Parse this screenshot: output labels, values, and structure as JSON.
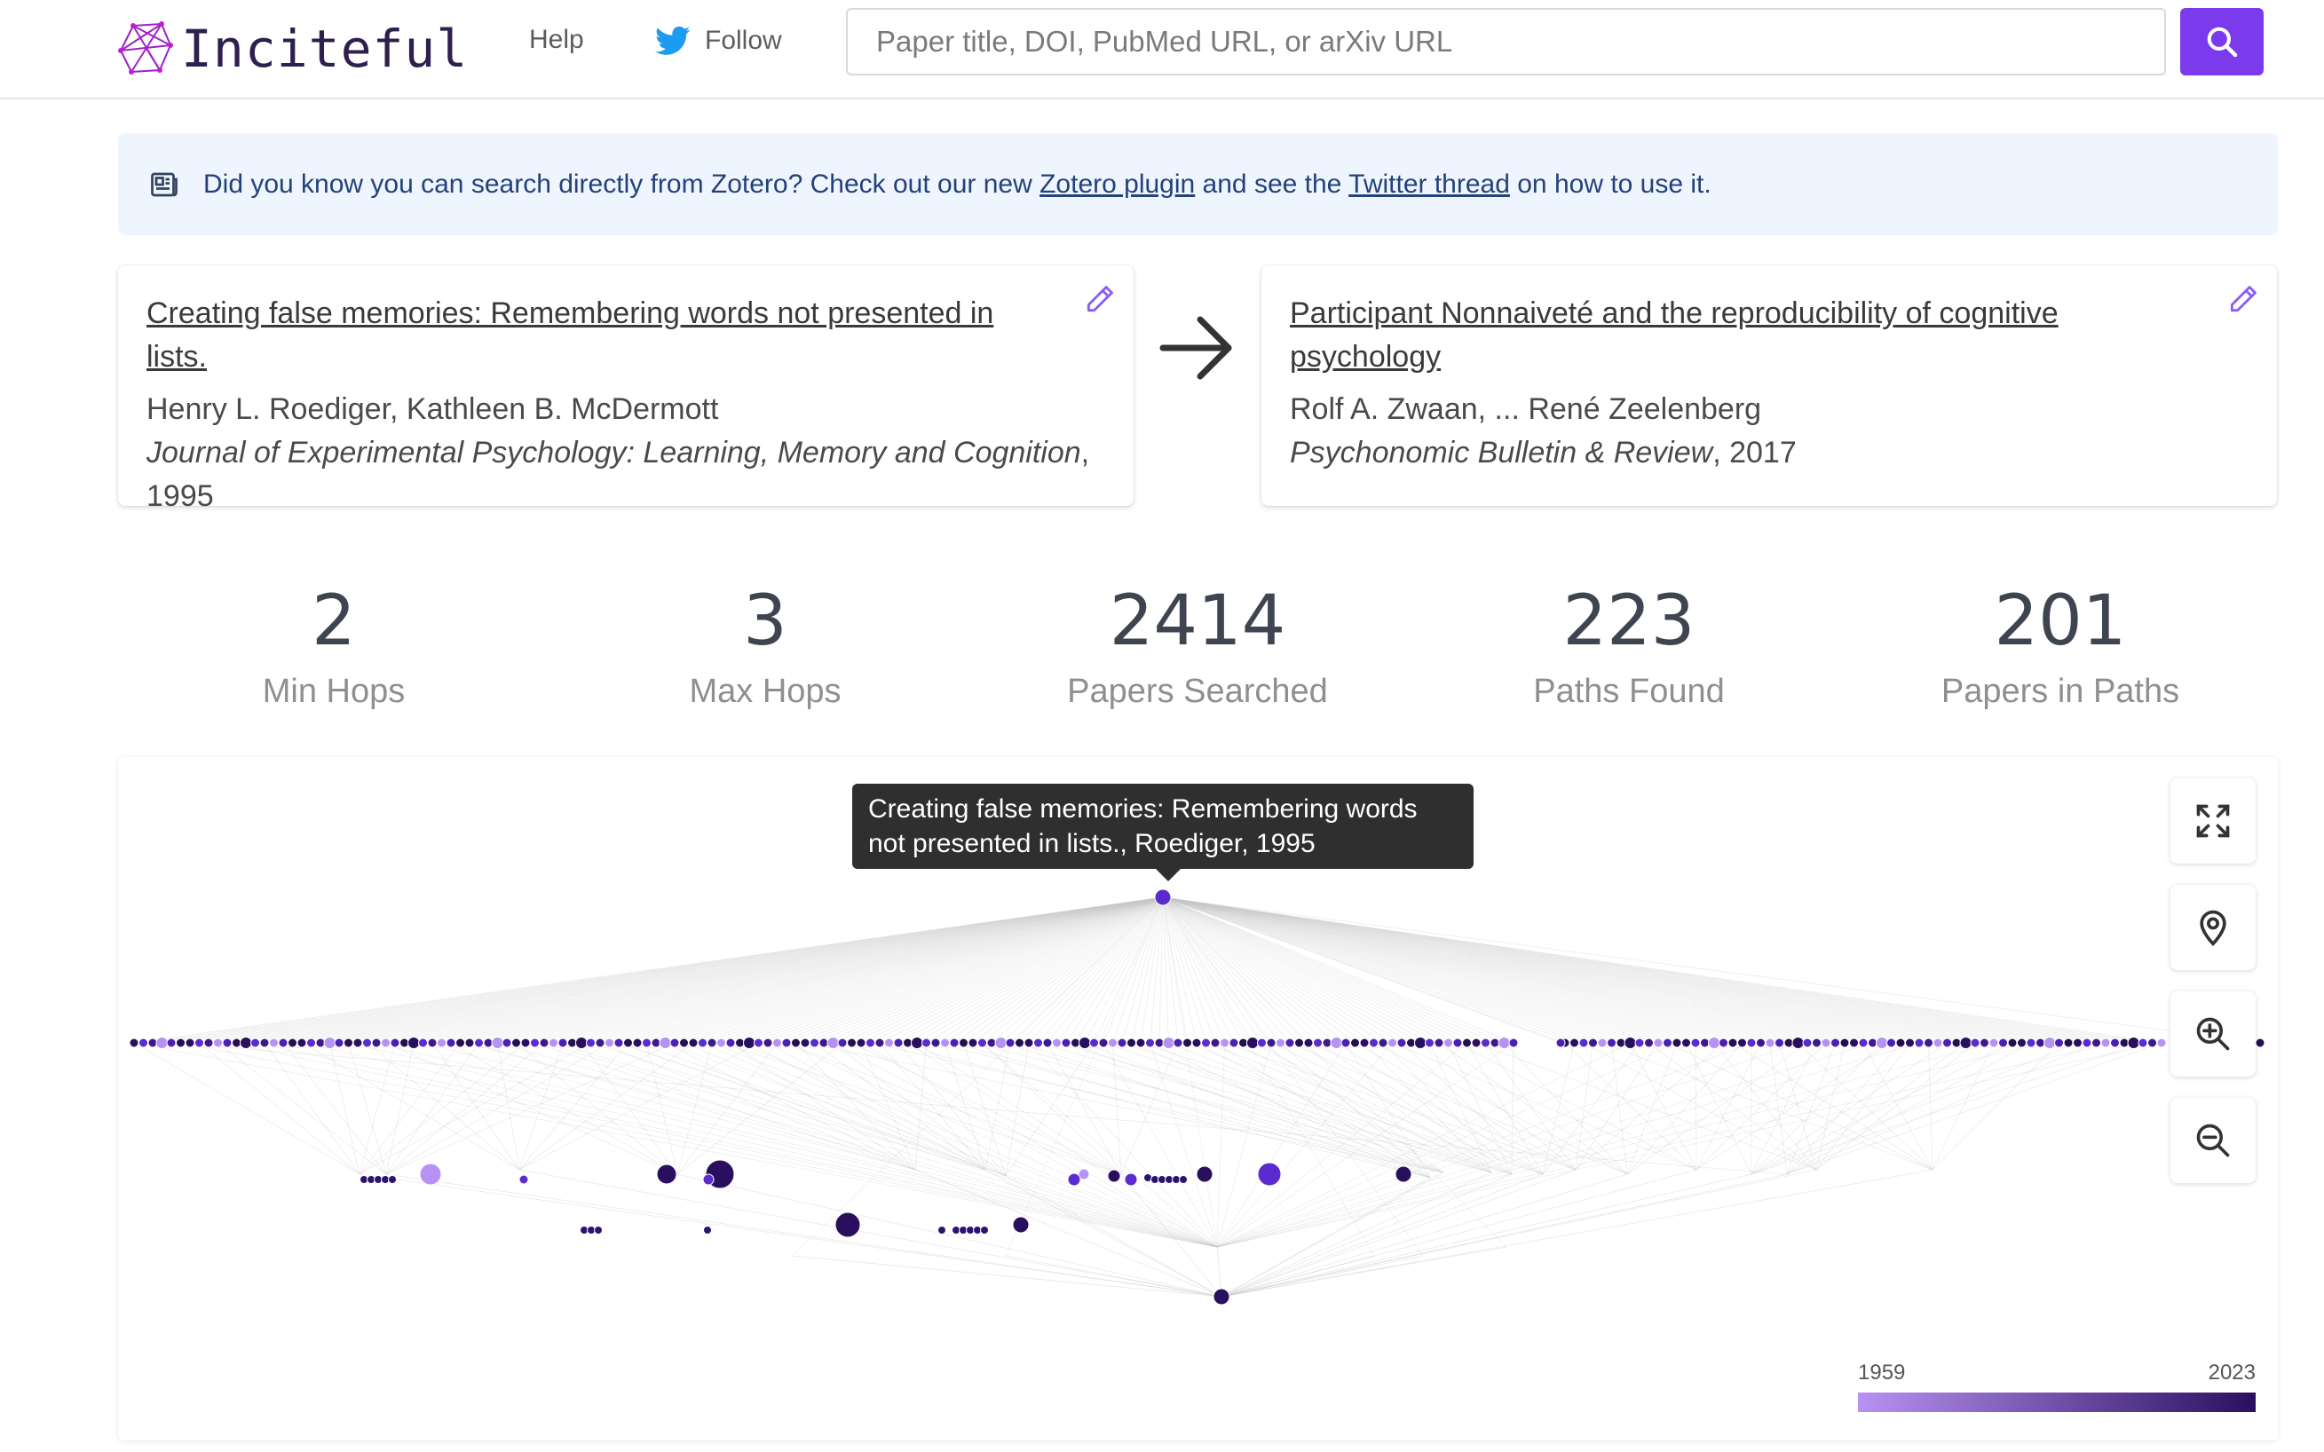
{
  "navbar": {
    "brand": "Inciteful",
    "help": "Help",
    "follow": "Follow",
    "search_placeholder": "Paper title, DOI, PubMed URL, or arXiv URL"
  },
  "notice": {
    "text_before": "Did you know you can search directly from Zotero? Check out our new ",
    "link1": "Zotero plugin",
    "text_middle": " and see the ",
    "link2": "Twitter thread",
    "text_after": " on how to use it."
  },
  "source_paper": {
    "title": "Creating false memories: Remembering words not presented in lists.",
    "authors": "Henry L. Roediger, Kathleen B. McDermott",
    "journal": "Journal of Experimental Psychology: Learning, Memory and Cognition",
    "year": "1995"
  },
  "target_paper": {
    "title": "Participant Nonnaiveté and the reproducibility of cognitive psychology",
    "authors": "Rolf A. Zwaan, ... René Zeelenberg",
    "journal": "Psychonomic Bulletin & Review",
    "year": "2017"
  },
  "stats": [
    {
      "value": "2",
      "label": "Min Hops"
    },
    {
      "value": "3",
      "label": "Max Hops"
    },
    {
      "value": "2414",
      "label": "Papers Searched"
    },
    {
      "value": "223",
      "label": "Paths Found"
    },
    {
      "value": "201",
      "label": "Papers in Paths"
    }
  ],
  "graph": {
    "tooltip": "Creating false memories: Remembering words not presented in lists., Roediger, 1995",
    "legend_min": "1959",
    "legend_max": "2023",
    "colors": {
      "old": "#b892f2",
      "new": "#2a0f5f",
      "mid": "#5b2bd0"
    }
  },
  "colors": {
    "accent": "#7c3aed",
    "notice_bg": "#eff5fe",
    "notice_text": "#23417a"
  }
}
